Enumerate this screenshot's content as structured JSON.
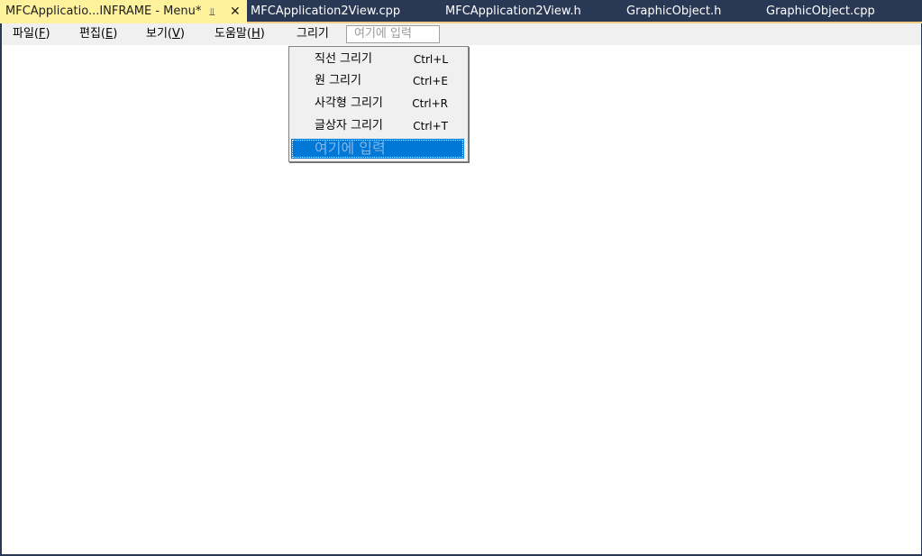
{
  "tabs": {
    "active": {
      "label": "MFCApplicatio...INFRAME - Menu*",
      "pin_icon": "pin-icon",
      "close_icon": "close-icon"
    },
    "others": [
      {
        "label": "MFCApplication2View.cpp"
      },
      {
        "label": "MFCApplication2View.h"
      },
      {
        "label": "GraphicObject.h"
      },
      {
        "label": "GraphicObject.cpp"
      }
    ]
  },
  "menubar": {
    "items": [
      {
        "text": "파일(",
        "mnemonic": "F",
        "close": ")"
      },
      {
        "text": "편집(",
        "mnemonic": "E",
        "close": ")"
      },
      {
        "text": "보기(",
        "mnemonic": "V",
        "close": ")"
      },
      {
        "text": "도움말(",
        "mnemonic": "H",
        "close": ")"
      },
      {
        "text": "그리기"
      }
    ],
    "type_here": "여기에 입력"
  },
  "dropdown": {
    "items": [
      {
        "label": "직선 그리기",
        "shortcut": "Ctrl+L"
      },
      {
        "label": "원 그리기",
        "shortcut": "Ctrl+E"
      },
      {
        "label": "사각형 그리기",
        "shortcut": "Ctrl+R"
      },
      {
        "label": "글상자 그리기",
        "shortcut": "Ctrl+T"
      }
    ],
    "type_here": "여기에 입력"
  },
  "colors": {
    "tabstrip": "#293955",
    "active_tab": "#fff29d",
    "menubar": "#f0f0f0",
    "selection": "#0078d7"
  }
}
